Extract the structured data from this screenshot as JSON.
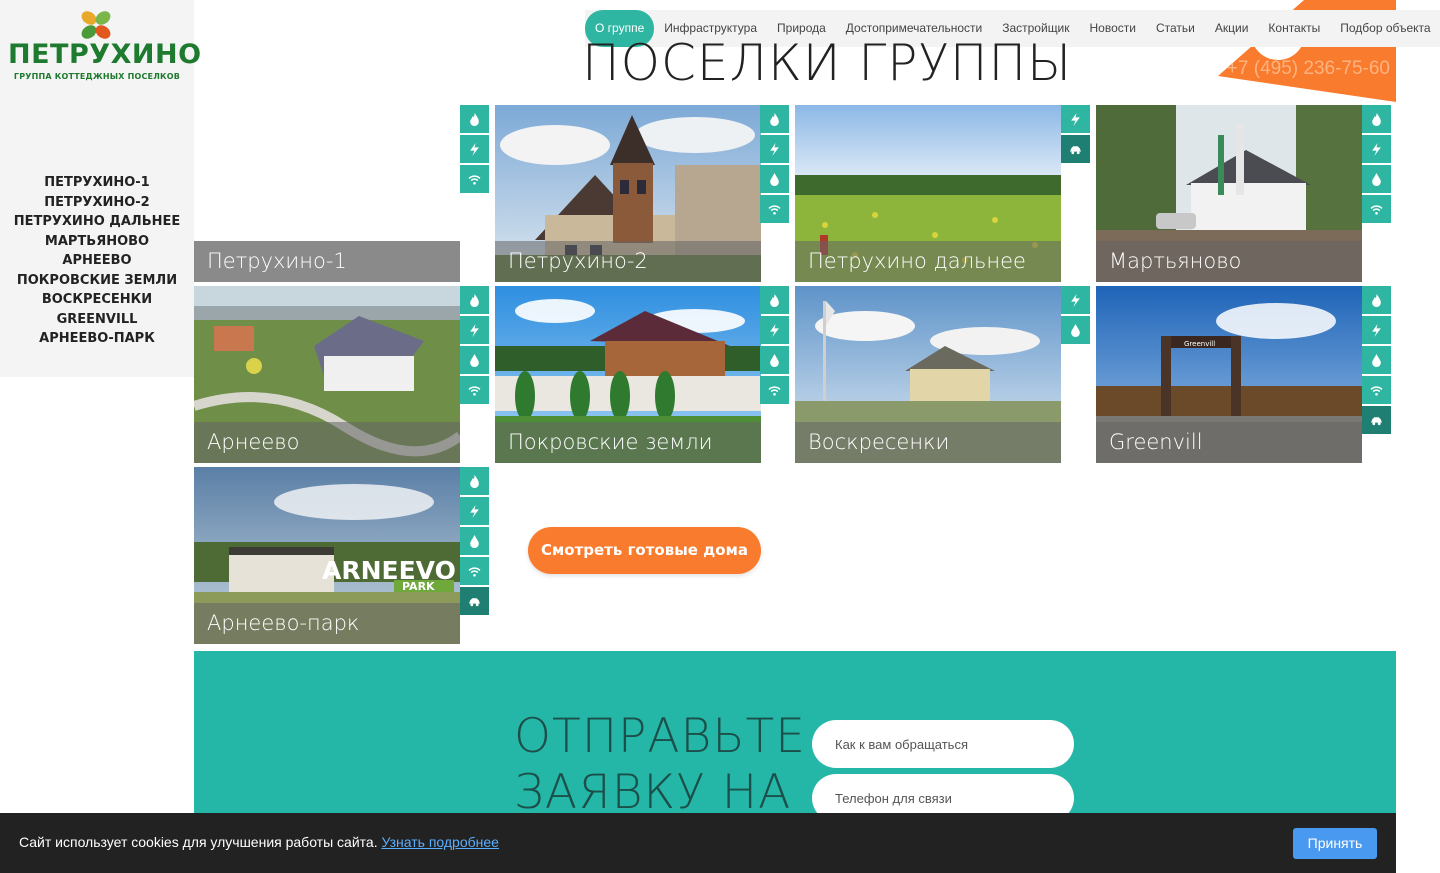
{
  "brand": {
    "name": "ПЕТРУХИНО",
    "subtitle": "ГРУППА КОТТЕДЖНЫХ ПОСЕЛКОВ"
  },
  "sidebar": {
    "items": [
      {
        "label": "ПЕТРУХИНО-1"
      },
      {
        "label": "ПЕТРУХИНО-2"
      },
      {
        "label": "ПЕТРУХИНО ДАЛЬНЕЕ"
      },
      {
        "label": "МАРТЬЯНОВО"
      },
      {
        "label": "АРНЕЕВО"
      },
      {
        "label": "ПОКРОВСКИЕ ЗЕМЛИ"
      },
      {
        "label": "ВОСКРЕСЕНКИ"
      },
      {
        "label": "GREENVILL"
      },
      {
        "label": "АРНЕЕВО-ПАРК"
      }
    ]
  },
  "nav": {
    "items": [
      {
        "label": "О группе",
        "active": true
      },
      {
        "label": "Инфраструктура"
      },
      {
        "label": "Природа"
      },
      {
        "label": "Достопримечательности"
      },
      {
        "label": "Застройщик"
      },
      {
        "label": "Новости"
      },
      {
        "label": "Статьи"
      },
      {
        "label": "Акции"
      },
      {
        "label": "Контакты"
      },
      {
        "label": "Подбор объекта"
      }
    ]
  },
  "header": {
    "phone": "+7 (495) 236-75-60",
    "title": "ПОСЕЛКИ ГРУППЫ"
  },
  "villages": [
    {
      "name": "Петрухино-1",
      "amenities": [
        "gas-icon",
        "electricity-icon",
        "wifi-icon"
      ]
    },
    {
      "name": "Петрухино-2",
      "amenities": [
        "gas-icon",
        "electricity-icon",
        "water-icon",
        "wifi-icon"
      ]
    },
    {
      "name": "Петрухино дальнее",
      "amenities": [
        "electricity-icon",
        "road-car-icon"
      ]
    },
    {
      "name": "Мартьяново",
      "amenities": [
        "gas-icon",
        "electricity-icon",
        "water-icon",
        "wifi-icon"
      ]
    },
    {
      "name": "Арнеево",
      "amenities": [
        "gas-icon",
        "electricity-icon",
        "water-icon",
        "wifi-icon"
      ]
    },
    {
      "name": "Покровские земли",
      "amenities": [
        "gas-icon",
        "electricity-icon",
        "water-icon",
        "wifi-icon"
      ]
    },
    {
      "name": "Воскресенки",
      "amenities": [
        "electricity-icon",
        "water-icon"
      ]
    },
    {
      "name": "Greenvill",
      "amenities": [
        "gas-icon",
        "electricity-icon",
        "water-icon",
        "wifi-icon",
        "road-car-icon"
      ]
    },
    {
      "name": "Арнеево-парк",
      "amenities": [
        "gas-icon",
        "electricity-icon",
        "water-icon",
        "wifi-icon",
        "road-car-icon"
      ]
    }
  ],
  "photo_text": {
    "arneevo_park_sign": "ARNEEVO",
    "arneevo_park_sign_sub": "PARK",
    "greenvill_sign": "Greenvill"
  },
  "cta": {
    "label": "Смотреть готовые дома"
  },
  "form": {
    "title_line1": "ОТПРАВЬТЕ",
    "title_line2": "ЗАЯВКУ НА",
    "name_placeholder": "Как к вам обращаться",
    "phone_placeholder": "Телефон для связи"
  },
  "cookie": {
    "text": "Сайт использует cookies для улучшения работы сайта.",
    "link": "Узнать подробнее",
    "accept": "Принять"
  },
  "colors": {
    "teal": "#2fb6a2",
    "teal_dark": "#1f7f72",
    "orange": "#f97b2d",
    "brand_green": "#1e7a2e",
    "form_bg": "#24b7a7",
    "cookie_bg": "#222222",
    "accept_blue": "#4a99f0"
  }
}
